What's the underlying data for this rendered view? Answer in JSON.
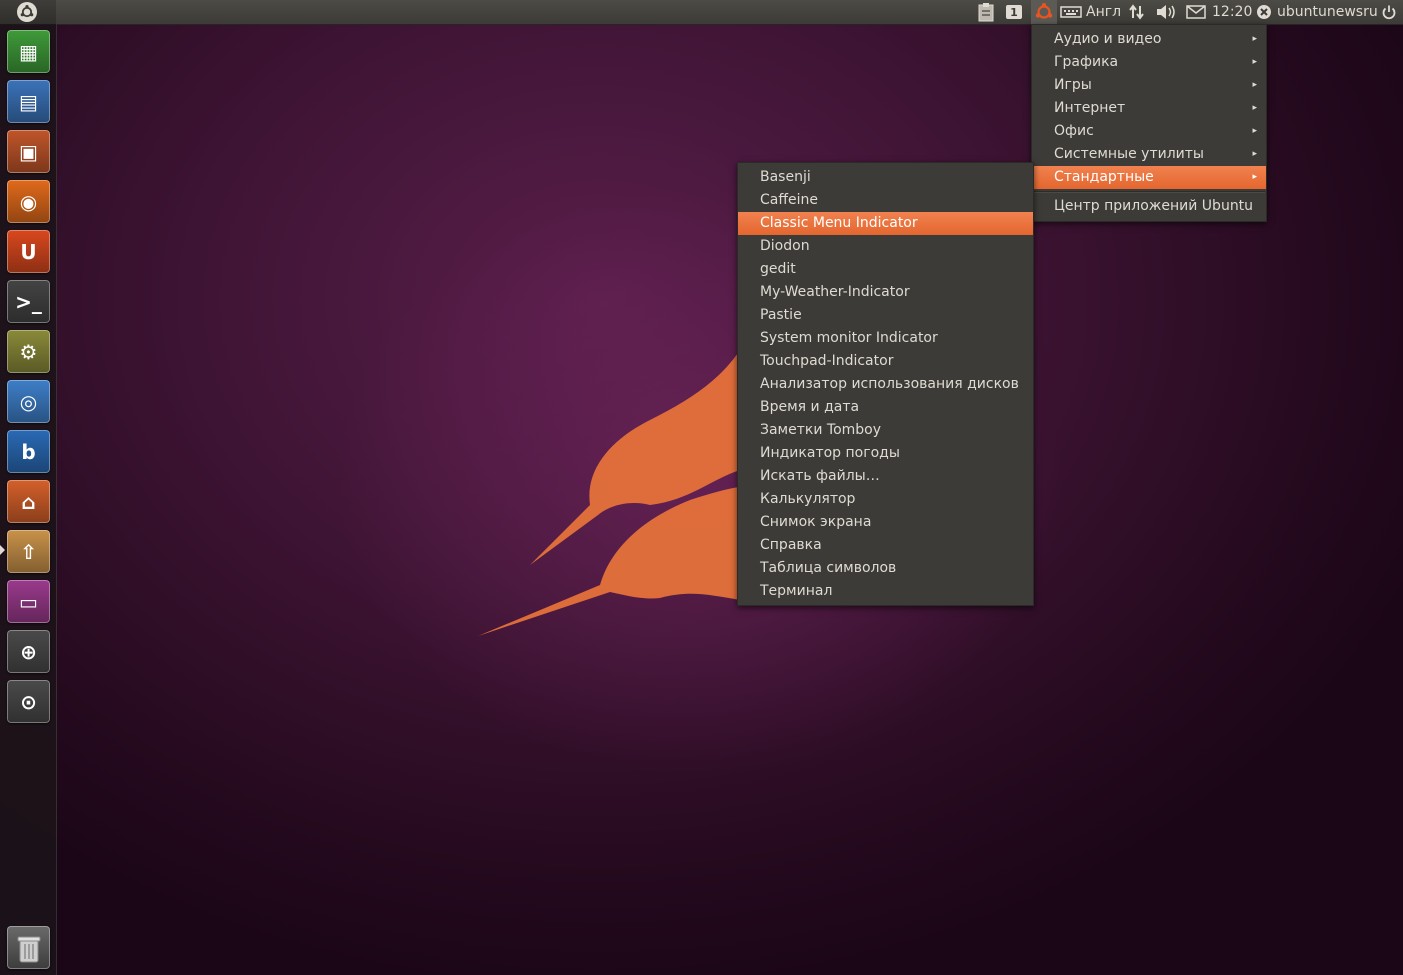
{
  "colors": {
    "panel": "#3c3b37",
    "accent": "#e95420",
    "menu_text": "#dfdbd2",
    "wallpaper": "#4a1840"
  },
  "top_panel": {
    "workspace_number": "1",
    "keyboard_layout": "Англ",
    "clock": "12:20",
    "username": "ubuntunewsru",
    "icons": [
      "ubuntu-logo-icon",
      "clipboard-icon",
      "workspace-icon",
      "classic-menu-icon",
      "keyboard-icon",
      "network-icon",
      "sound-icon",
      "mail-icon",
      "user-status-icon",
      "power-icon"
    ]
  },
  "launcher": {
    "items": [
      {
        "name": "libreoffice-calc-icon",
        "color": "#3f9b3a"
      },
      {
        "name": "libreoffice-writer-icon",
        "color": "#3b73b9"
      },
      {
        "name": "libreoffice-impress-icon",
        "color": "#c0552a"
      },
      {
        "name": "firefox-icon",
        "color": "#e06a1b"
      },
      {
        "name": "ubuntu-software-center-icon",
        "color": "#d9481e"
      },
      {
        "name": "terminal-icon",
        "color": "#444444"
      },
      {
        "name": "app-installer-icon",
        "color": "#8a8a3a"
      },
      {
        "name": "chromium-icon",
        "color": "#3e7fc8"
      },
      {
        "name": "blue-b-app-icon",
        "color": "#2a6ab5"
      },
      {
        "name": "home-folder-icon",
        "color": "#d4602a"
      },
      {
        "name": "update-manager-icon",
        "color": "#c9924a"
      },
      {
        "name": "workspace-switcher-icon",
        "color": "#9a3a8c"
      },
      {
        "name": "dash-search-icon",
        "color": "#4a4a4a"
      },
      {
        "name": "file-search-icon",
        "color": "#4a4a4a"
      }
    ],
    "trash": {
      "name": "trash-icon"
    }
  },
  "main_menu": {
    "items": [
      {
        "label": "Аудио и видео",
        "submenu": true,
        "active": false
      },
      {
        "label": "Графика",
        "submenu": true,
        "active": false
      },
      {
        "label": "Игры",
        "submenu": true,
        "active": false
      },
      {
        "label": "Интернет",
        "submenu": true,
        "active": false
      },
      {
        "label": "Офис",
        "submenu": true,
        "active": false
      },
      {
        "label": "Системные утилиты",
        "submenu": true,
        "active": false
      },
      {
        "label": "Стандартные",
        "submenu": true,
        "active": true
      }
    ],
    "footer_item": "Центр приложений Ubuntu",
    "arrow": "▸"
  },
  "sub_menu": {
    "items": [
      {
        "label": "Basenji",
        "active": false
      },
      {
        "label": "Caffeine",
        "active": false
      },
      {
        "label": "Classic Menu Indicator",
        "active": true
      },
      {
        "label": "Diodon",
        "active": false
      },
      {
        "label": "gedit",
        "active": false
      },
      {
        "label": "My-Weather-Indicator",
        "active": false
      },
      {
        "label": "Pastie",
        "active": false
      },
      {
        "label": "System monitor Indicator",
        "active": false
      },
      {
        "label": "Touchpad-Indicator",
        "active": false
      },
      {
        "label": "Анализатор использования дисков",
        "active": false
      },
      {
        "label": "Время и дата",
        "active": false
      },
      {
        "label": "Заметки Tomboy",
        "active": false
      },
      {
        "label": "Индикатор погоды",
        "active": false
      },
      {
        "label": "Искать файлы…",
        "active": false
      },
      {
        "label": "Калькулятор",
        "active": false
      },
      {
        "label": "Снимок экрана",
        "active": false
      },
      {
        "label": "Справка",
        "active": false
      },
      {
        "label": "Таблица символов",
        "active": false
      },
      {
        "label": "Терминал",
        "active": false
      }
    ]
  }
}
